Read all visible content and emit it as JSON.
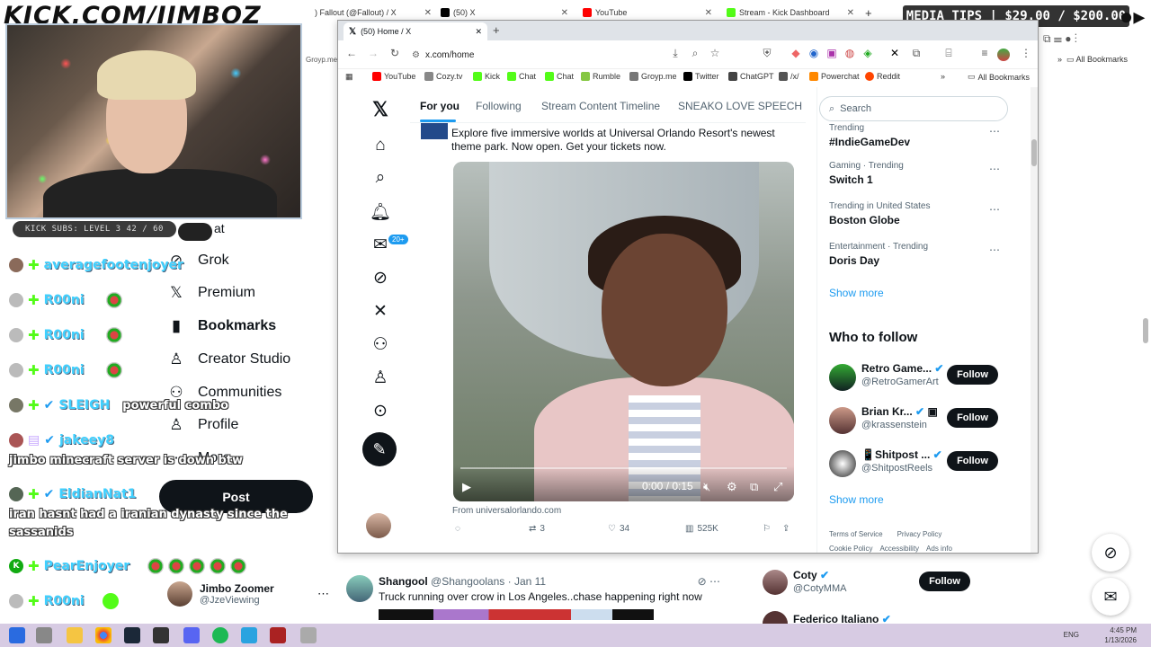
{
  "overlay": {
    "kick_url": "KICK.COM/JIMBOZ",
    "media_tips": "MEDIA TIPS | $29.00 / $200.00",
    "kick_subs": "KICK SUBS: LEVEL 3 42 / 60"
  },
  "browser_tabs_back": [
    {
      "label": ") Fallout (@Fallout) / X"
    },
    {
      "label": "(50) X"
    },
    {
      "label": "YouTube"
    },
    {
      "label": "Stream - Kick Dashboard"
    }
  ],
  "chat": [
    {
      "user": "averagefootenjoyer",
      "message": ""
    },
    {
      "user": "R00ni",
      "message": ""
    },
    {
      "user": "R00ni",
      "message": ""
    },
    {
      "user": "R00ni",
      "message": ""
    },
    {
      "user": "SLEIGH",
      "message": "powerful combo"
    },
    {
      "user": "jakeey8",
      "message": "jimbo minecraft server is down btw"
    },
    {
      "user": "EldianNat1",
      "message": "iran hasnt had a iranian dynasty since the sassanids"
    },
    {
      "user": "PearEnjoyer",
      "message": ""
    },
    {
      "user": "R00ni",
      "message": ""
    }
  ],
  "chat_msg_line2": "sassanids",
  "chat_msg_line1": "iran hasnt had a iranian dynasty since the",
  "leftnav": {
    "chat": "at",
    "grok": "Grok",
    "premium": "Premium",
    "bookmarks": "Bookmarks",
    "creator_studio": "Creator Studio",
    "communities": "Communities",
    "profile": "Profile",
    "more": "More",
    "post": "Post",
    "account_name": "Jimbo Zoomer",
    "account_handle": "@JzeViewing"
  },
  "window": {
    "tab_title": "(50) Home / X",
    "url": "x.com/home",
    "bookmarks": [
      "YouTube",
      "Cozy.tv",
      "Kick",
      "Chat",
      "Chat",
      "Rumble",
      "Groyp.me",
      "Twitter",
      "ChatGPT",
      "/x/",
      "Powerchat",
      "Reddit"
    ],
    "all_bookmarks": "All Bookmarks"
  },
  "x": {
    "notif_badge": "20+",
    "tabs": [
      "For you",
      "Following",
      "Stream Content Timeline",
      "SNEAKO LOVE SPEECH"
    ],
    "ad_text": "Explore five immersive worlds at Universal Orlando Resort's newest theme park. Now open. Get your tickets now.",
    "video_time": "0:00 / 0:15",
    "video_progress": 0.0,
    "from": "From universalorlando.com",
    "retweets": "3",
    "likes": "34",
    "views": "525K",
    "search_placeholder": "Search",
    "trends": [
      {
        "category": "Trending",
        "name": "#IndieGameDev"
      },
      {
        "category": "Gaming · Trending",
        "name": "Switch 1"
      },
      {
        "category": "Trending in United States",
        "name": "Boston Globe"
      },
      {
        "category": "Entertainment · Trending",
        "name": "Doris Day"
      }
    ],
    "show_more": "Show more",
    "who_to_follow": "Who to follow",
    "follow_suggestions": [
      {
        "name": "Retro Game...",
        "handle": "@RetroGamerArt",
        "button": "Follow"
      },
      {
        "name": "Brian Kr...",
        "handle": "@krassenstein",
        "button": "Follow"
      },
      {
        "name": "📱Shitpost ...",
        "handle": "@ShitpostReels",
        "button": "Follow"
      }
    ],
    "footer_links": [
      "Terms of Service",
      "Privacy Policy",
      "Cookie Policy",
      "Accessibility",
      "Ads info"
    ]
  },
  "background_tweet": {
    "name": "Shangool",
    "handle": "@Shangoolans",
    "date": "· Jan 11",
    "text": "Truck running over crow in Los Angeles..chase happening right now"
  },
  "background_follow": [
    {
      "name": "Coty",
      "handle": "@CotyMMA",
      "button": "Follow"
    },
    {
      "name": "Federico Italiano",
      "handle": "",
      "button": ""
    }
  ],
  "taskbar": {
    "lang": "ENG",
    "time": "4:45 PM",
    "date": "1/13/2026"
  },
  "colors": {
    "x_blue": "#1d9bf0",
    "kick_green": "#53fc18",
    "dark": "#0f1419"
  }
}
